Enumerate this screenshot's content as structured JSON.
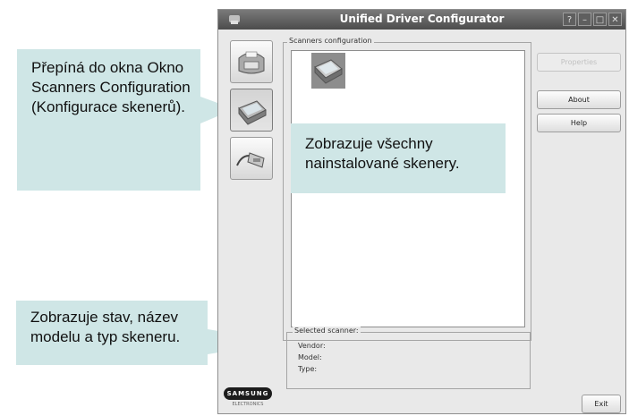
{
  "window": {
    "title": "Unified Driver Configurator",
    "controls": [
      "?",
      "–",
      "□",
      "✕"
    ]
  },
  "sidebar": {
    "modes": [
      {
        "name": "printers",
        "icon": "printer-icon",
        "active": false
      },
      {
        "name": "scanners",
        "icon": "scanner-icon",
        "active": true
      },
      {
        "name": "ports",
        "icon": "port-icon",
        "active": false
      }
    ]
  },
  "scanners_group": {
    "label": "Scanners configuration"
  },
  "selected_scanner": {
    "label": "Selected scanner:",
    "vendor_label": "Vendor:",
    "model_label": "Model:",
    "type_label": "Type:"
  },
  "buttons": {
    "properties": "Properties",
    "about": "About",
    "help": "Help",
    "exit": "Exit"
  },
  "brand": {
    "logo": "SAMSUNG",
    "sub": "ELECTRONICS"
  },
  "callouts": {
    "mode_switch": "Přepíná do okna Okno Scanners Configuration (Konfigurace skenerů).",
    "installed_scanners": "Zobrazuje všechny nainstalované skenery.",
    "status": "Zobrazuje stav, název modelu a typ skeneru."
  },
  "colors": {
    "callout_bg": "#cfe6e6",
    "titlebar": "#4c4c4c",
    "window_bg": "#e9e9e9"
  }
}
